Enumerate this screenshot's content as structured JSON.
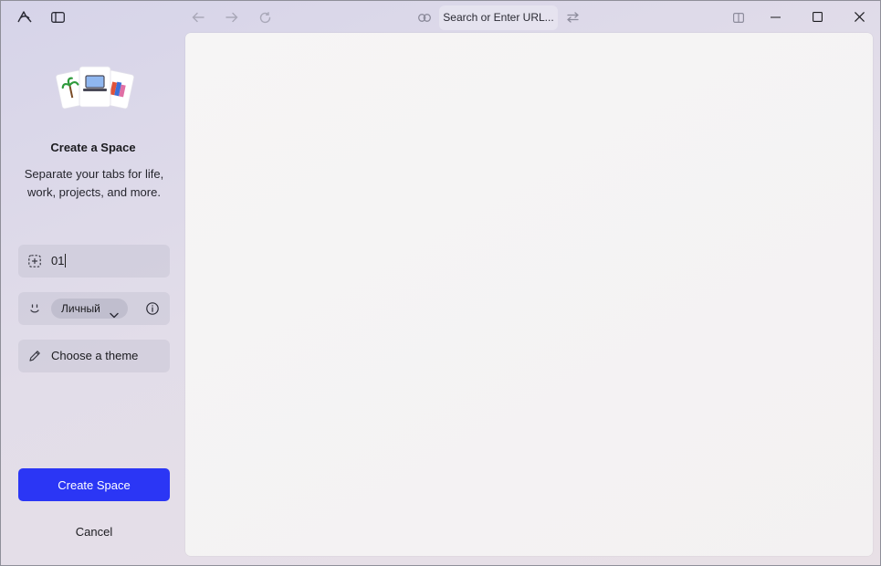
{
  "titlebar": {
    "url_placeholder": "Search or Enter URL..."
  },
  "icons": {
    "app_logo": "arc-logo-icon",
    "sidebar_toggle": "sidebar-toggle-icon",
    "back": "arrow-left-icon",
    "forward": "arrow-right-icon",
    "reload": "reload-icon",
    "link": "link-icon",
    "site_controls": "sliders-icon",
    "split_view": "split-view-icon",
    "minimize": "minimize-icon",
    "maximize": "maximize-icon",
    "close": "close-icon"
  },
  "sidebar": {
    "title": "Create a Space",
    "description": "Separate your tabs for life, work, projects, and more.",
    "name_field": {
      "value": "01",
      "icon": "dashed-square-icon"
    },
    "profile_field": {
      "icon": "smiley-icon",
      "selected_profile": "Личный",
      "info_icon": "info-icon"
    },
    "theme_field": {
      "label": "Choose a theme",
      "icon": "pen-icon"
    },
    "create_button": "Create Space",
    "cancel_button": "Cancel"
  },
  "colors": {
    "primary_button": "#2b36f5",
    "window_background": "#dcd8e8",
    "content_background": "#f5f4f4"
  }
}
